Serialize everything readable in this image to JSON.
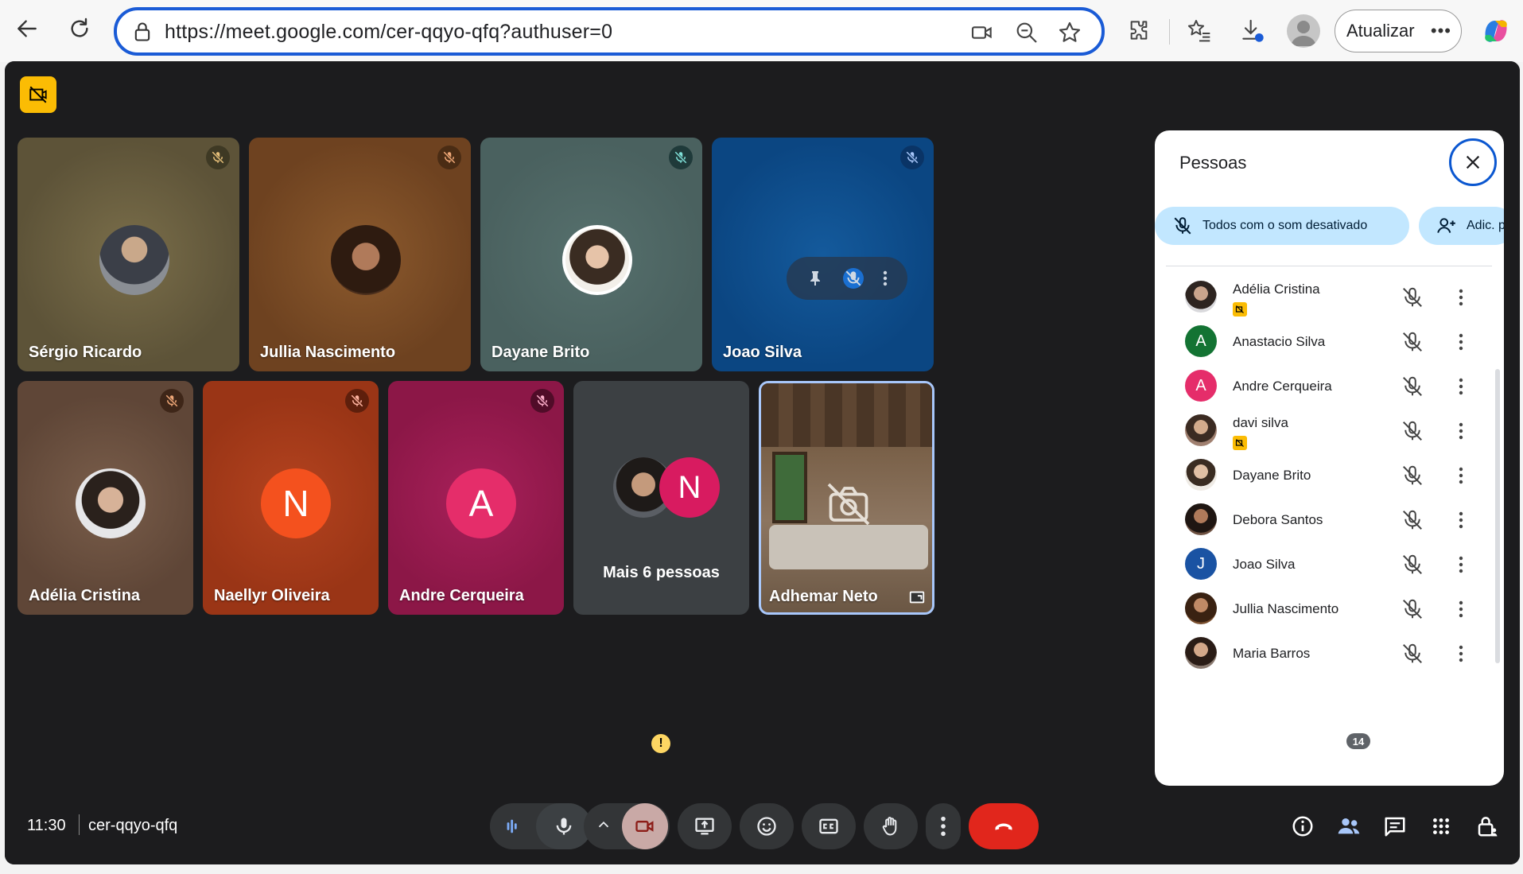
{
  "browser": {
    "url": "https://meet.google.com/cer-qqyo-qfq?authuser=0",
    "update_label": "Atualizar",
    "more_label": "•••"
  },
  "colors": {
    "accent": "#0b57d0",
    "end_call": "#e1261c",
    "warning": "#fdd663",
    "chip": "#c2e7ff"
  },
  "tiles_row1": [
    {
      "name": "Sérgio Ricardo",
      "bg": "#6b5f3f"
    },
    {
      "name": "Jullia Nascimento",
      "bg": "#7a4a26"
    },
    {
      "name": "Dayane Brito",
      "bg": "#4f6664"
    },
    {
      "name": "Joao Silva",
      "bg": "#0d4f8f"
    }
  ],
  "tiles_row2": [
    {
      "name": "Adélia Cristina",
      "bg": "#6a5040"
    },
    {
      "name": "Naellyr Oliveira",
      "bg": "#a8391a",
      "letter": "N",
      "letter_bg": "#f4511e"
    },
    {
      "name": "Andre Cerqueira",
      "bg": "#9c1c52",
      "letter": "A",
      "letter_bg": "#e52d6a"
    },
    {
      "more_label": "Mais 6 pessoas",
      "letter": "N",
      "letter_bg": "#d81b60"
    },
    {
      "name": "Adhemar Neto"
    }
  ],
  "meeting": {
    "time": "11:30",
    "code": "cer-qqyo-qfq",
    "warning": "!",
    "people_count": "14"
  },
  "panel": {
    "title": "Pessoas",
    "mute_all_label": "Todos com o som desativado",
    "add_label": "Adic. p",
    "people": [
      {
        "name": "Adélia Cristina",
        "photo": true,
        "badge": true
      },
      {
        "name": "Anastacio Silva",
        "letter": "A",
        "color": "#137333"
      },
      {
        "name": "Andre Cerqueira",
        "letter": "A",
        "color": "#e52d6a"
      },
      {
        "name": "davi silva",
        "photo": true,
        "badge": true
      },
      {
        "name": "Dayane Brito",
        "photo": true
      },
      {
        "name": "Debora Santos",
        "photo": true
      },
      {
        "name": "Joao Silva",
        "letter": "J",
        "color": "#1a53a3"
      },
      {
        "name": "Jullia Nascimento",
        "photo": true
      },
      {
        "name": "Maria Barros",
        "photo": true
      }
    ]
  }
}
